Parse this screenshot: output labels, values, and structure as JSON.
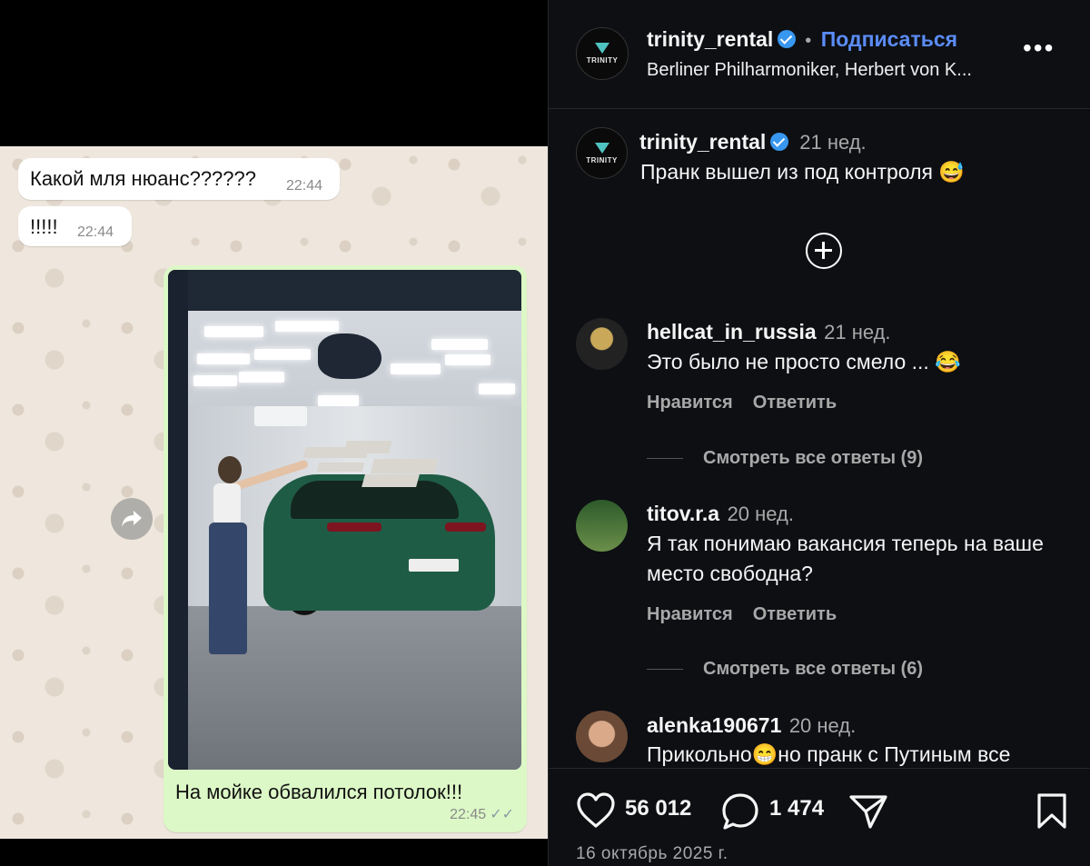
{
  "chat": {
    "messages": [
      {
        "text": "Какой мля нюанс??????",
        "time": "22:44"
      },
      {
        "text": "!!!!!",
        "time": "22:44"
      }
    ],
    "photo_caption": "На мойке обвалился потолок!!!",
    "photo_time": "22:45",
    "ticks": "✓✓"
  },
  "post": {
    "author": "trinity_rental",
    "logo_text": "TRINITY",
    "follow_label": "Подписаться",
    "separator": "•",
    "audio": "Berliner Philharmoniker, Herbert von K...",
    "more_label": "•••",
    "caption_time": "21 нед.",
    "caption_text": "Пранк вышел из под контроля 😅",
    "likes": "56 012",
    "comments_count": "1 474",
    "date": "16 октябрь 2025 г."
  },
  "comments": [
    {
      "user": "hellcat_in_russia",
      "time": "21 нед.",
      "text": "Это было не просто смело ... 😂",
      "like_label": "Нравится",
      "reply_label": "Ответить",
      "replies": "Смотреть все ответы (9)"
    },
    {
      "user": "titov.r.a",
      "time": "20 нед.",
      "text": "Я так понимаю вакансия теперь на ваше место свободна?",
      "like_label": "Нравится",
      "reply_label": "Ответить",
      "replies": "Смотреть все ответы (6)"
    },
    {
      "user": "alenka190671",
      "time": "20 нед.",
      "text": "Прикольно😁но пранк с Путиным все"
    }
  ],
  "colors": {
    "accent_link": "#5b8cf7",
    "verified": "#3897f0",
    "panel_bg": "#0d0f13",
    "chat_out": "#dcf8c6"
  }
}
